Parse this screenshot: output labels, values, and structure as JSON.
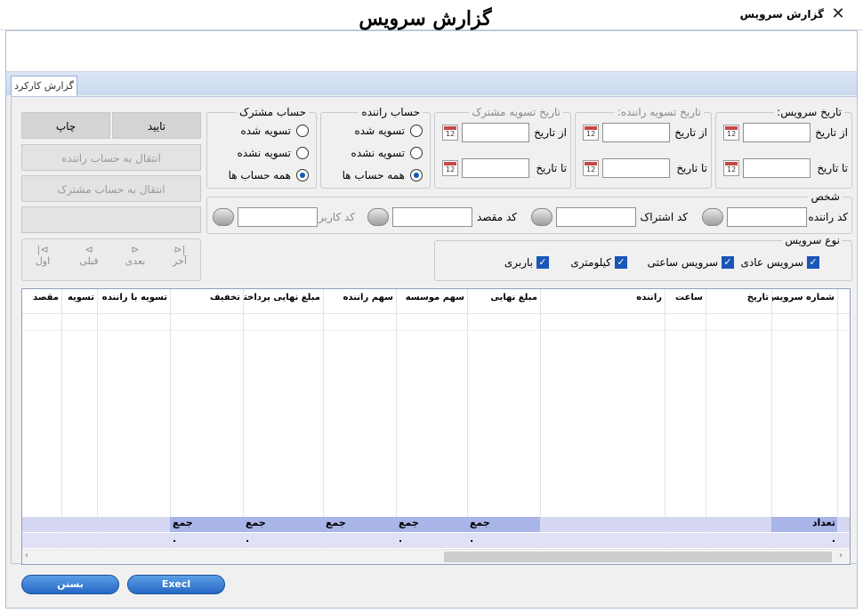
{
  "window": {
    "title": "گزارش سرویس",
    "close": "✕"
  },
  "header": {
    "title": "گزارش سرویس"
  },
  "tab": {
    "label": "گزارش کارکرد"
  },
  "service_date": {
    "title": "تاریخ سرویس:",
    "from": "از تاریخ",
    "to": "تا تاریخ"
  },
  "driver_settle_date": {
    "title": "تاریخ تسویه راننده:",
    "from": "از تاریخ",
    "to": "تا تاریخ"
  },
  "customer_settle_date": {
    "title": "تاریخ تسویه مشترک",
    "from": "از تاریخ",
    "to": "تا تاریخ"
  },
  "driver_account": {
    "title": "حساب راننده",
    "options": [
      "تسویه شده",
      "تسویه نشده",
      "همه حساب ها"
    ],
    "selected": "همه حساب ها"
  },
  "customer_account": {
    "title": "حساب مشترک",
    "options": [
      "تسویه شده",
      "تسویه نشده",
      "همه حساب ها"
    ],
    "selected": "همه حساب ها"
  },
  "person": {
    "title": "شخص",
    "driver_code": "کد راننده",
    "subscriber_code": "کد اشتراک",
    "destination_code": "کد مقصد",
    "user_code": "کد کاربر"
  },
  "service_type": {
    "title": "نوع سرویس",
    "items": [
      "سرویس عادی",
      "سرویس ساعتی",
      "کیلومتری",
      "باربری"
    ]
  },
  "actions": {
    "confirm": "تایید",
    "print": "چاپ",
    "to_driver": "انتقال به حساب راننده",
    "to_customer": "انتقال به حساب مشترک"
  },
  "nav": {
    "last": "آخر",
    "next": "بعدی",
    "prev": "قبلی",
    "first": "اول"
  },
  "table": {
    "columns": [
      "شماره سرویس",
      "تاریخ",
      "ساعت",
      "راننده",
      "مبلغ نهایی",
      "سهم موسسه",
      "سهم راننده",
      "مبلغ نهایی پرداختی",
      "تخفیف",
      "تسویه با راننده",
      "تسویه",
      "مقصد"
    ],
    "count_label": "تعداد",
    "sum_label": "جمع",
    "zero": "."
  },
  "footer": {
    "excel": "Execl",
    "close": "بستن"
  }
}
